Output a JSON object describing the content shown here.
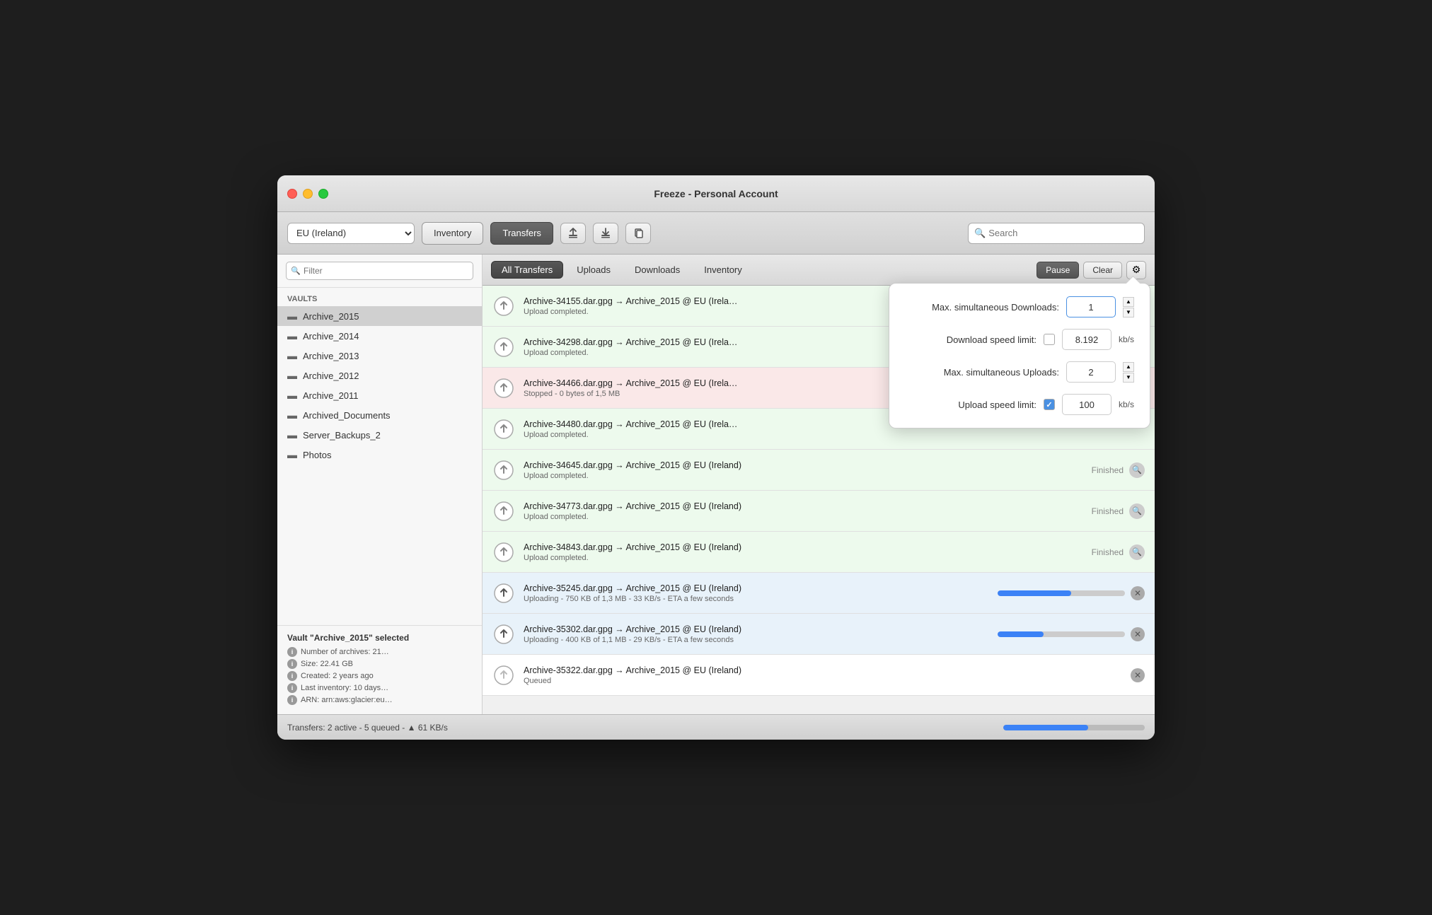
{
  "window": {
    "title": "Freeze - Personal Account"
  },
  "toolbar": {
    "region": "EU (Ireland)",
    "inventory_tab": "Inventory",
    "transfers_tab": "Transfers",
    "search_placeholder": "Search"
  },
  "sidebar": {
    "filter_placeholder": "Filter",
    "vaults_label": "Vaults",
    "vaults": [
      {
        "name": "Archive_2015",
        "selected": true
      },
      {
        "name": "Archive_2014",
        "selected": false
      },
      {
        "name": "Archive_2013",
        "selected": false
      },
      {
        "name": "Archive_2012",
        "selected": false
      },
      {
        "name": "Archive_2011",
        "selected": false
      },
      {
        "name": "Archived_Documents",
        "selected": false
      },
      {
        "name": "Server_Backups_2",
        "selected": false
      },
      {
        "name": "Photos",
        "selected": false
      }
    ],
    "info_title": "Vault \"Archive_2015\" selected",
    "info_rows": [
      "Number of archives: 21…",
      "Size: 22.41 GB",
      "Created: 2 years ago",
      "Last inventory: 10 days…",
      "ARN: arn:aws:glacier:eu…"
    ]
  },
  "transfers": {
    "tabs": [
      "All Transfers",
      "Uploads",
      "Downloads",
      "Inventory"
    ],
    "active_tab": "All Transfers",
    "pause_label": "Pause",
    "clear_label": "Clear",
    "items": [
      {
        "name": "Archive-34155.dar.gpg → Archive_2015 @ EU (Irela…",
        "status": "Upload completed.",
        "state": "finished",
        "progress": null
      },
      {
        "name": "Archive-34298.dar.gpg → Archive_2015 @ EU (Irela…",
        "status": "Upload completed.",
        "state": "finished",
        "progress": null
      },
      {
        "name": "Archive-34466.dar.gpg → Archive_2015 @ EU (Irela…",
        "status": "Stopped - 0 bytes of 1,5 MB",
        "state": "stopped",
        "progress": null
      },
      {
        "name": "Archive-34480.dar.gpg → Archive_2015 @ EU (Irela…",
        "status": "Upload completed.",
        "state": "finished",
        "progress": null
      },
      {
        "name": "Archive-34645.dar.gpg → Archive_2015 @ EU (Ireland)",
        "status": "Upload completed.",
        "state": "finished",
        "progress": null,
        "show_finished": true
      },
      {
        "name": "Archive-34773.dar.gpg → Archive_2015 @ EU (Ireland)",
        "status": "Upload completed.",
        "state": "finished",
        "progress": null,
        "show_finished": true
      },
      {
        "name": "Archive-34843.dar.gpg → Archive_2015 @ EU (Ireland)",
        "status": "Upload completed.",
        "state": "finished",
        "progress": null,
        "show_finished": true
      },
      {
        "name": "Archive-35245.dar.gpg → Archive_2015 @ EU (Ireland)",
        "status": "Uploading - 750 KB of 1,3 MB - 33 KB/s - ETA a few seconds",
        "state": "active",
        "progress": 58
      },
      {
        "name": "Archive-35302.dar.gpg → Archive_2015 @ EU (Ireland)",
        "status": "Uploading - 400 KB of 1,1 MB - 29 KB/s - ETA a few seconds",
        "state": "active",
        "progress": 36
      },
      {
        "name": "Archive-35322.dar.gpg → Archive_2015 @ EU (Ireland)",
        "status": "Queued",
        "state": "queued",
        "progress": null
      }
    ]
  },
  "status_bar": {
    "text": "Transfers: 2 active - 5 queued - ▲ 61 KB/s"
  },
  "popover": {
    "max_downloads_label": "Max. simultaneous Downloads:",
    "max_downloads_value": "1",
    "download_speed_label": "Download speed limit:",
    "download_speed_value": "8.192",
    "download_speed_unit": "kb/s",
    "max_uploads_label": "Max. simultaneous Uploads:",
    "max_uploads_value": "2",
    "upload_speed_label": "Upload speed limit:",
    "upload_speed_value": "100",
    "upload_speed_unit": "kb/s",
    "upload_speed_checked": true
  }
}
